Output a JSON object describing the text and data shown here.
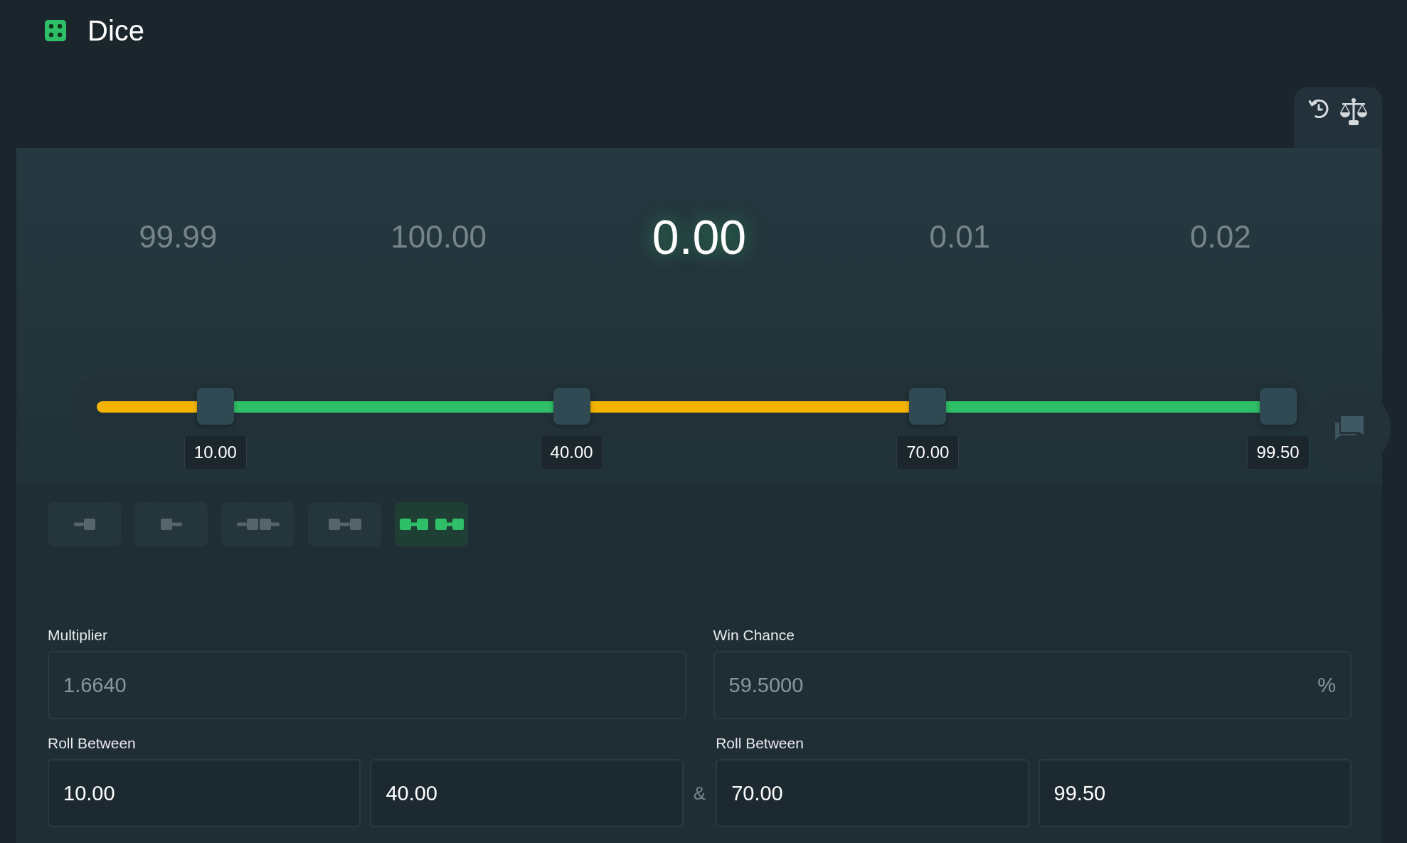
{
  "header": {
    "title": "Dice"
  },
  "results": [
    {
      "value": "99.99",
      "selected": false
    },
    {
      "value": "100.00",
      "selected": false
    },
    {
      "value": "0.00",
      "selected": true
    },
    {
      "value": "0.01",
      "selected": false
    },
    {
      "value": "0.02",
      "selected": false
    }
  ],
  "slider": {
    "thumbs": [
      {
        "level": 0.1,
        "label": "10.00"
      },
      {
        "level": 0.4,
        "label": "40.00"
      },
      {
        "level": 0.7,
        "label": "70.00"
      },
      {
        "level": 0.995,
        "label": "99.50"
      }
    ],
    "segments": [
      {
        "color": "#f5b400"
      },
      {
        "color": "#2fbf68"
      },
      {
        "color": "#f5b400"
      },
      {
        "color": "#2fbf68"
      }
    ]
  },
  "modes": [
    {
      "kind": "under",
      "selected": false
    },
    {
      "kind": "over",
      "selected": false
    },
    {
      "kind": "outside",
      "selected": false
    },
    {
      "kind": "between",
      "selected": false
    },
    {
      "kind": "double-between",
      "selected": true
    }
  ],
  "multiplier": {
    "label": "Multiplier",
    "value": "1.6640",
    "disabled": true
  },
  "win_chance": {
    "label": "Win Chance",
    "value": "59.5000",
    "suffix": "%",
    "disabled": true
  },
  "roll_between": [
    {
      "label": "Roll Between",
      "from": "10.00",
      "to": "40.00"
    },
    {
      "label": "Roll Between",
      "from": "70.00",
      "to": "99.50"
    }
  ],
  "joiner": "&"
}
